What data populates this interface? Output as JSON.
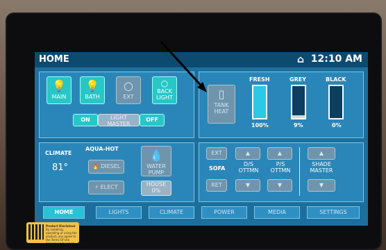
{
  "status": {
    "title": "HOME",
    "time": "12:10 AM"
  },
  "lights": {
    "main_label": "MAIN",
    "bath_label": "BATH",
    "ext_label": "EXT",
    "backlight_label_1": "BACK",
    "backlight_label_2": "LIGHT",
    "on_label": "ON",
    "master_label_1": "LIGHT",
    "master_label_2": "MASTER",
    "off_label": "OFF"
  },
  "tanks": {
    "heat_label_1": "TANK",
    "heat_label_2": "HEAT",
    "fresh": {
      "name": "FRESH",
      "percent_text": "100%",
      "level": 1.0
    },
    "grey": {
      "name": "GREY",
      "percent_text": "9%",
      "level": 0.09
    },
    "black": {
      "name": "BLACK",
      "percent_text": "0%",
      "level": 0.0
    }
  },
  "climate": {
    "label": "CLIMATE",
    "temp": "81°",
    "aquahot_label": "AQUA-HOT",
    "diesel_label": "DIESEL",
    "elect_label": "ELECT",
    "water_pump_1": "WATER",
    "water_pump_2": "PUMP",
    "house_label": "HOUSE",
    "house_percent": "0%"
  },
  "slides": {
    "ext_label": "EXT",
    "sofa_label": "SOFA",
    "ret_label": "RET",
    "ds_ottmn_1": "D/S",
    "ds_ottmn_2": "OTTMN",
    "ps_ottmn_1": "P/S",
    "ps_ottmn_2": "OTTMN",
    "shade_1": "SHADE",
    "shade_2": "MASTER"
  },
  "tabs": [
    "HOME",
    "LIGHTS",
    "CLIMATE",
    "POWER",
    "MEDIA",
    "SETTINGS"
  ],
  "sticker": {
    "title": "Product Disclaimer",
    "body": "By installing, operating or using the product, you agree to the Terms Of Use Agreement found at www.spyderco.com"
  },
  "colors": {
    "screen_bg": "#1c6f9c",
    "accent_teal": "#29c6c6",
    "header": "#0d4a70"
  }
}
